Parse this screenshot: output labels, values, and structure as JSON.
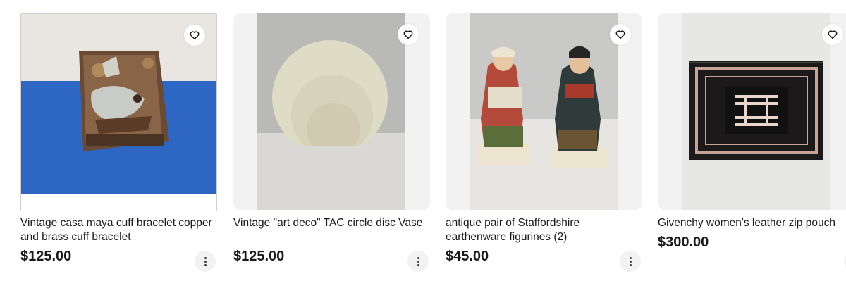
{
  "listings": [
    {
      "title": "Vintage casa maya cuff bracelet copper and brass cuff bracelet",
      "price": "$125.00",
      "image": "copper-brass-cuff-bracelet-photo"
    },
    {
      "title": "Vintage \"art deco\" TAC circle disc Vase",
      "price": "$125.00",
      "image": "cream-disc-vase-photo"
    },
    {
      "title": "antique pair of Staffordshire earthenware figurines (2)",
      "price": "$45.00",
      "image": "staffordshire-figurines-photo"
    },
    {
      "title": "Givenchy women's leather zip pouch",
      "price": "$300.00",
      "image": "givenchy-pouch-photo"
    }
  ],
  "icons": {
    "watch": "heart-icon",
    "more": "more-vertical-icon"
  }
}
